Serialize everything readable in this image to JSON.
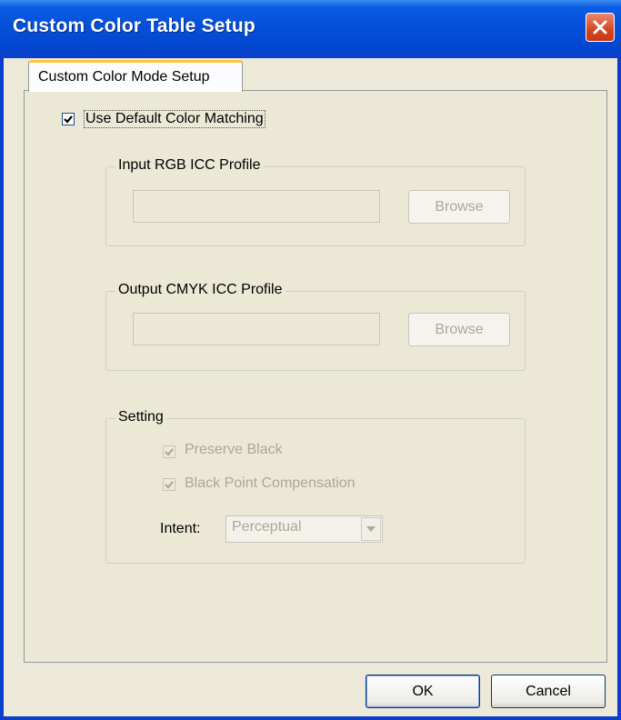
{
  "window": {
    "title": "Custom Color Table Setup"
  },
  "tabs": [
    {
      "label": "Custom Color Mode Setup"
    }
  ],
  "use_default": {
    "label": "Use Default Color Matching",
    "checked": true
  },
  "input_profile": {
    "title": "Input RGB ICC Profile",
    "value": "",
    "browse_label": "Browse"
  },
  "output_profile": {
    "title": "Output CMYK ICC Profile",
    "value": "",
    "browse_label": "Browse"
  },
  "setting": {
    "title": "Setting",
    "preserve_black": {
      "label": "Preserve Black",
      "checked": true
    },
    "black_point": {
      "label": "Black Point Compensation",
      "checked": true
    },
    "intent_label": "Intent:",
    "intent_value": "Perceptual"
  },
  "buttons": {
    "ok": "OK",
    "cancel": "Cancel"
  },
  "icons": {
    "close": "close-icon",
    "check": "checkmark-icon",
    "dropdown": "chevron-down-icon"
  },
  "colors": {
    "titlebar": "#0a5de3",
    "window_bg": "#ece9d8",
    "close_button": "#d5451f",
    "tab_highlight": "#ffc83c",
    "disabled_text": "#aca899"
  }
}
